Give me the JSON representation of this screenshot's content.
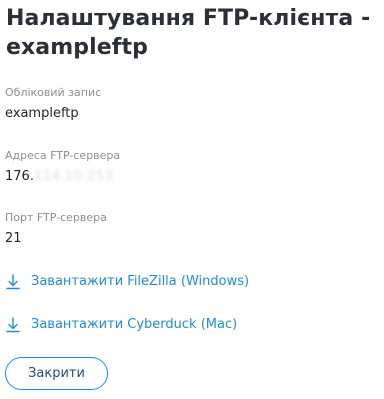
{
  "dialog": {
    "title": "Налаштування FTP-клієнта - exampleftp",
    "close_label": "Закрити"
  },
  "fields": {
    "account": {
      "label": "Обліковий запис",
      "value": "exampleftp"
    },
    "host": {
      "label": "Адреса FTP-сервера",
      "value_prefix": "176.",
      "value_hidden": "114.10.253"
    },
    "port": {
      "label": "Порт FTP-сервера",
      "value": "21"
    }
  },
  "downloads": [
    {
      "label": "Завантажити FileZilla (Windows)",
      "icon": "download-icon"
    },
    {
      "label": "Завантажити Cyberduck (Mac)",
      "icon": "download-icon"
    }
  ],
  "colors": {
    "accent": "#1f8dd6",
    "title": "#2b3038",
    "muted": "#8a9099"
  }
}
